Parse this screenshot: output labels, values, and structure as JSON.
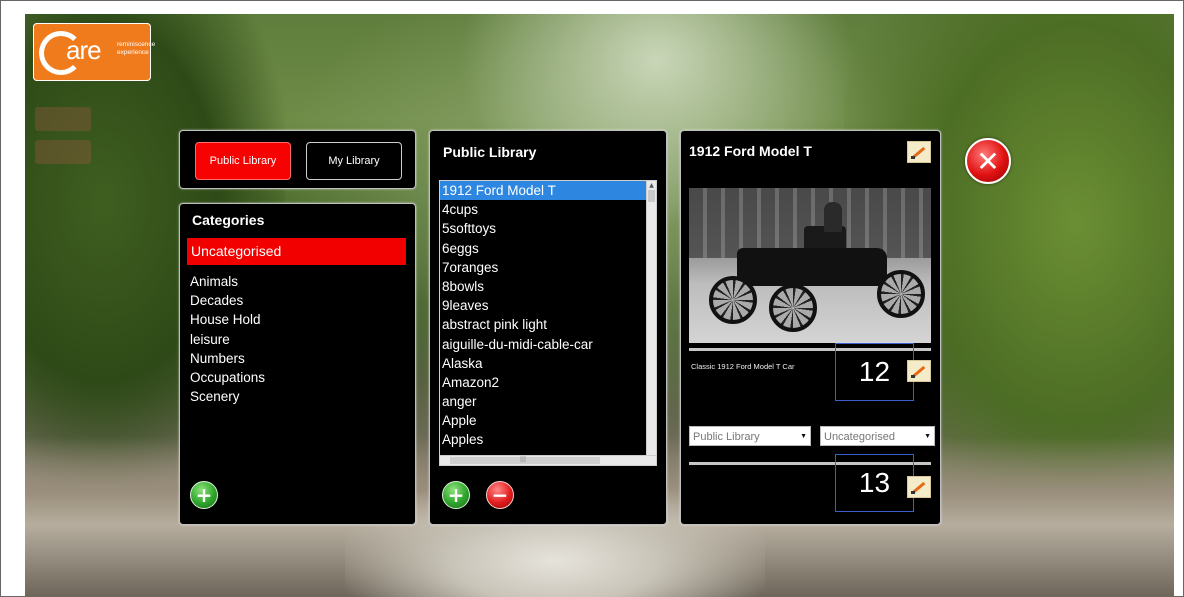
{
  "brand": {
    "logo_letter": "C",
    "logo_word": "are",
    "logo_tagline_1": "reminiscence",
    "logo_tagline_2": "experience"
  },
  "library_toggle": {
    "public_label": "Public Library",
    "my_label": "My Library",
    "active": "public"
  },
  "categories": {
    "title": "Categories",
    "selected": "Uncategorised",
    "items": [
      "Animals",
      "Decades",
      "House Hold",
      "leisure",
      "Numbers",
      "Occupations",
      "Scenery"
    ],
    "add_icon": "plus-icon"
  },
  "library_list": {
    "title": "Public Library",
    "selected": "1912 Ford Model T",
    "items": [
      "4cups",
      "5softtoys",
      "6eggs",
      "7oranges",
      "8bowls",
      "9leaves",
      "abstract pink light",
      "aiguille-du-midi-cable-car",
      "Alaska",
      "Amazon2",
      "anger",
      "Apple",
      "Apples"
    ],
    "add_icon": "plus-icon",
    "remove_icon": "minus-icon"
  },
  "detail": {
    "title": "1912 Ford Model T",
    "caption": "Classic 1912 Ford Model T Car",
    "library_select": "Public Library",
    "category_select": "Uncategorised",
    "box_1": "12",
    "box_2": "13",
    "edit_icon": "edit-pencil-icon"
  },
  "close_icon": "close-x-icon",
  "colors": {
    "accent_red": "#f70202",
    "selection_blue": "#2d86e0",
    "logo_orange": "#f07b1d"
  }
}
